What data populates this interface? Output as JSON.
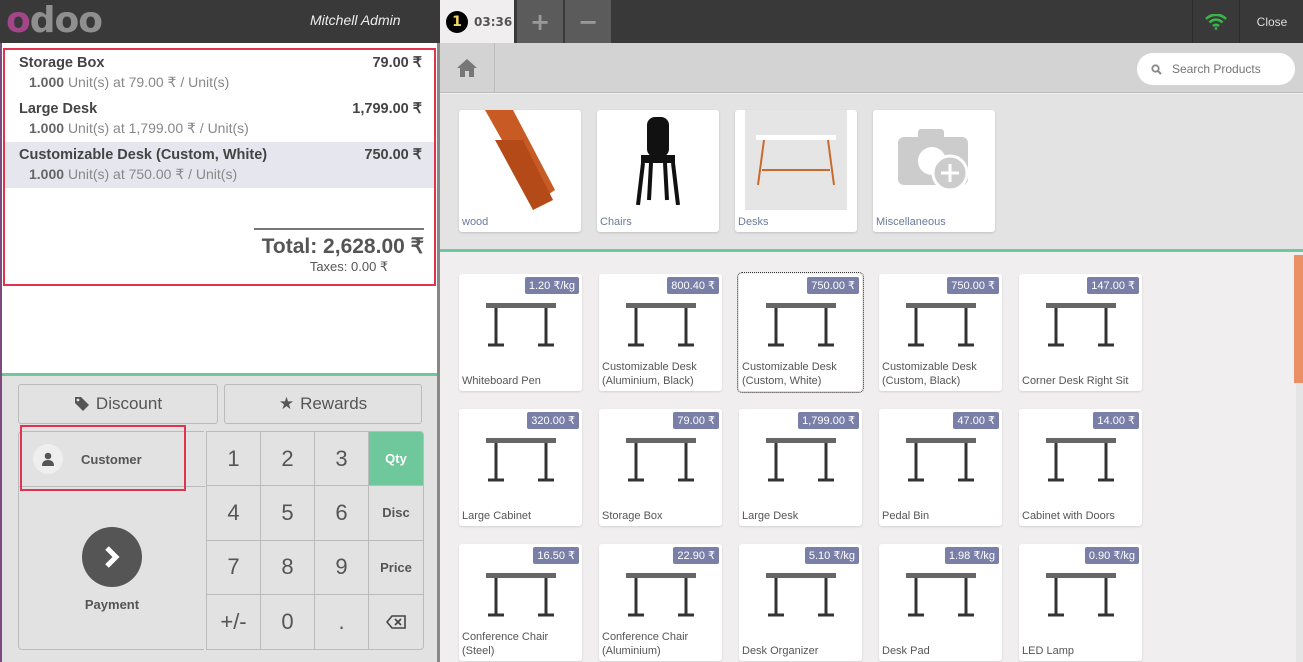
{
  "header": {
    "logo": [
      "o",
      "d",
      "o",
      "o"
    ],
    "user_name": "Mitchell Admin",
    "order_tab": {
      "number": "1",
      "time": "03:36"
    },
    "add_order_label": "+",
    "remove_order_label": "−",
    "close_label": "Close",
    "wifi_color": "#3bb54a"
  },
  "order": {
    "lines": [
      {
        "name": "Storage Box",
        "price": "79.00 ₹",
        "qty": "1.000",
        "detail": "Unit(s) at 79.00 ₹ / Unit(s)",
        "selected": false
      },
      {
        "name": "Large Desk",
        "price": "1,799.00 ₹",
        "qty": "1.000",
        "detail": "Unit(s) at 1,799.00 ₹ / Unit(s)",
        "selected": false
      },
      {
        "name": "Customizable Desk (Custom, White)",
        "price": "750.00 ₹",
        "qty": "1.000",
        "detail": "Unit(s) at 750.00 ₹ / Unit(s)",
        "selected": true
      }
    ],
    "total": "Total: 2,628.00 ₹",
    "taxes": "Taxes: 0.00 ₹"
  },
  "controls": {
    "discount_label": "Discount",
    "rewards_label": "Rewards",
    "customer_label": "Customer",
    "payment_label": "Payment",
    "numpad": [
      "1",
      "2",
      "3",
      "Qty",
      "4",
      "5",
      "6",
      "Disc",
      "7",
      "8",
      "9",
      "Price",
      "+/-",
      "0",
      ".",
      "⌫"
    ],
    "active_mode": "Qty"
  },
  "search": {
    "placeholder": "Search Products"
  },
  "categories": [
    {
      "label": "wood",
      "icon": "wood-planks-image"
    },
    {
      "label": "Chairs",
      "icon": "chair-image"
    },
    {
      "label": "Desks",
      "icon": "desk-image"
    },
    {
      "label": "Miscellaneous",
      "icon": "camera-placeholder-image"
    }
  ],
  "products": [
    {
      "name": "Whiteboard Pen",
      "price": "1.20 ₹/kg"
    },
    {
      "name": "Customizable Desk (Aluminium, Black)",
      "price": "800.40 ₹"
    },
    {
      "name": "Customizable Desk (Custom, White)",
      "price": "750.00 ₹",
      "selected": true
    },
    {
      "name": "Customizable Desk (Custom, Black)",
      "price": "750.00 ₹"
    },
    {
      "name": "Corner Desk Right Sit",
      "price": "147.00 ₹"
    },
    {
      "name": "Large Cabinet",
      "price": "320.00 ₹"
    },
    {
      "name": "Storage Box",
      "price": "79.00 ₹"
    },
    {
      "name": "Large Desk",
      "price": "1,799.00 ₹"
    },
    {
      "name": "Pedal Bin",
      "price": "47.00 ₹"
    },
    {
      "name": "Cabinet with Doors",
      "price": "14.00 ₹"
    },
    {
      "name": "Conference Chair (Steel)",
      "price": "16.50 ₹"
    },
    {
      "name": "Conference Chair (Aluminium)",
      "price": "22.90 ₹"
    },
    {
      "name": "Desk Organizer",
      "price": "5.10 ₹/kg"
    },
    {
      "name": "Desk Pad",
      "price": "1.98 ₹/kg"
    },
    {
      "name": "LED Lamp",
      "price": "0.90 ₹/kg"
    }
  ],
  "colors": {
    "accent": "#6ec89b",
    "highlight": "#e0344e",
    "price_badge": "#7a7fa8",
    "brand": "#875a7b"
  }
}
